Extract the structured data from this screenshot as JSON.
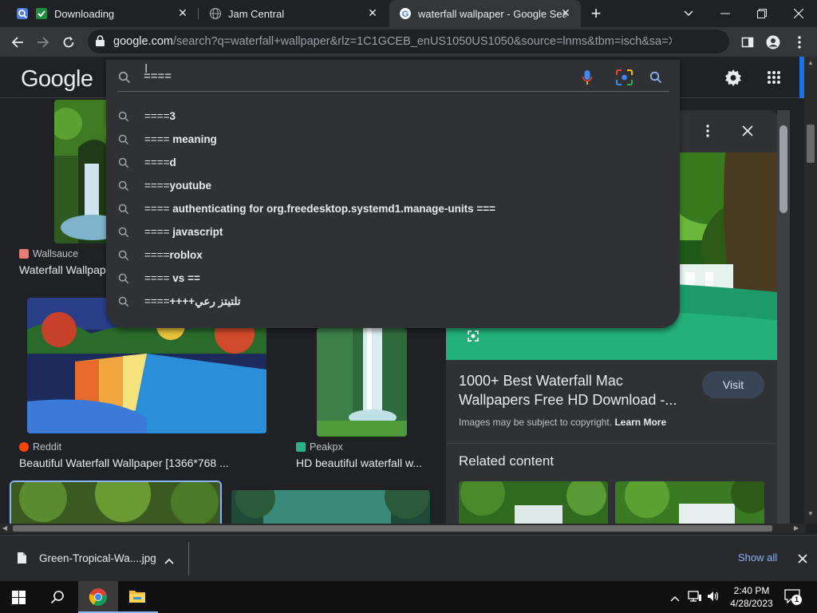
{
  "tabs": [
    {
      "title": "Downloading",
      "active": false
    },
    {
      "title": "Jam Central",
      "active": false
    },
    {
      "title": "waterfall wallpaper - Google Sea",
      "active": true
    }
  ],
  "toolbar": {
    "url_host": "google.com",
    "url_path": "/search?q=waterfall+wallpaper&rlz=1C1GCEB_enUS1050US1050&source=lnms&tbm=isch&sa=X&v..."
  },
  "google": {
    "logo": "Google",
    "search_value": "===="
  },
  "suggestions": [
    {
      "prefix": "====",
      "bold": "3"
    },
    {
      "prefix": "====",
      "bold": " meaning"
    },
    {
      "prefix": "====",
      "bold": "d"
    },
    {
      "prefix": "====",
      "bold": "youtube"
    },
    {
      "prefix": "====",
      "bold": " authenticating for org.freedesktop.systemd1.manage-units ==="
    },
    {
      "prefix": "====",
      "bold": " javascript"
    },
    {
      "prefix": "====",
      "bold": "roblox"
    },
    {
      "prefix": "====",
      "bold": " vs =="
    },
    {
      "prefix": "====",
      "bold": "++++تلتيتز رعي"
    }
  ],
  "results": [
    {
      "source": "Wallsauce",
      "caption": "Waterfall Wallpap"
    },
    {
      "source": "Reddit",
      "caption": "Beautiful Waterfall Wallpaper [1366*768 ..."
    },
    {
      "source": "Peakpx",
      "caption": "HD beautiful waterfall w..."
    }
  ],
  "panel": {
    "title": "1000+ Best Waterfall Mac Wallpapers Free HD Download -...",
    "visit_label": "Visit",
    "copyright_text": "Images may be subject to copyright.",
    "learn_more": "Learn More",
    "related_heading": "Related content"
  },
  "downloads": {
    "file_name": "Green-Tropical-Wa....jpg",
    "show_all": "Show all"
  },
  "taskbar": {
    "time": "2:40 PM",
    "date": "4/28/2023",
    "notification_count": "1"
  },
  "colors": {
    "accent_blue": "#8ab4f8",
    "bg_dark": "#202124",
    "panel_bg": "#303134"
  }
}
